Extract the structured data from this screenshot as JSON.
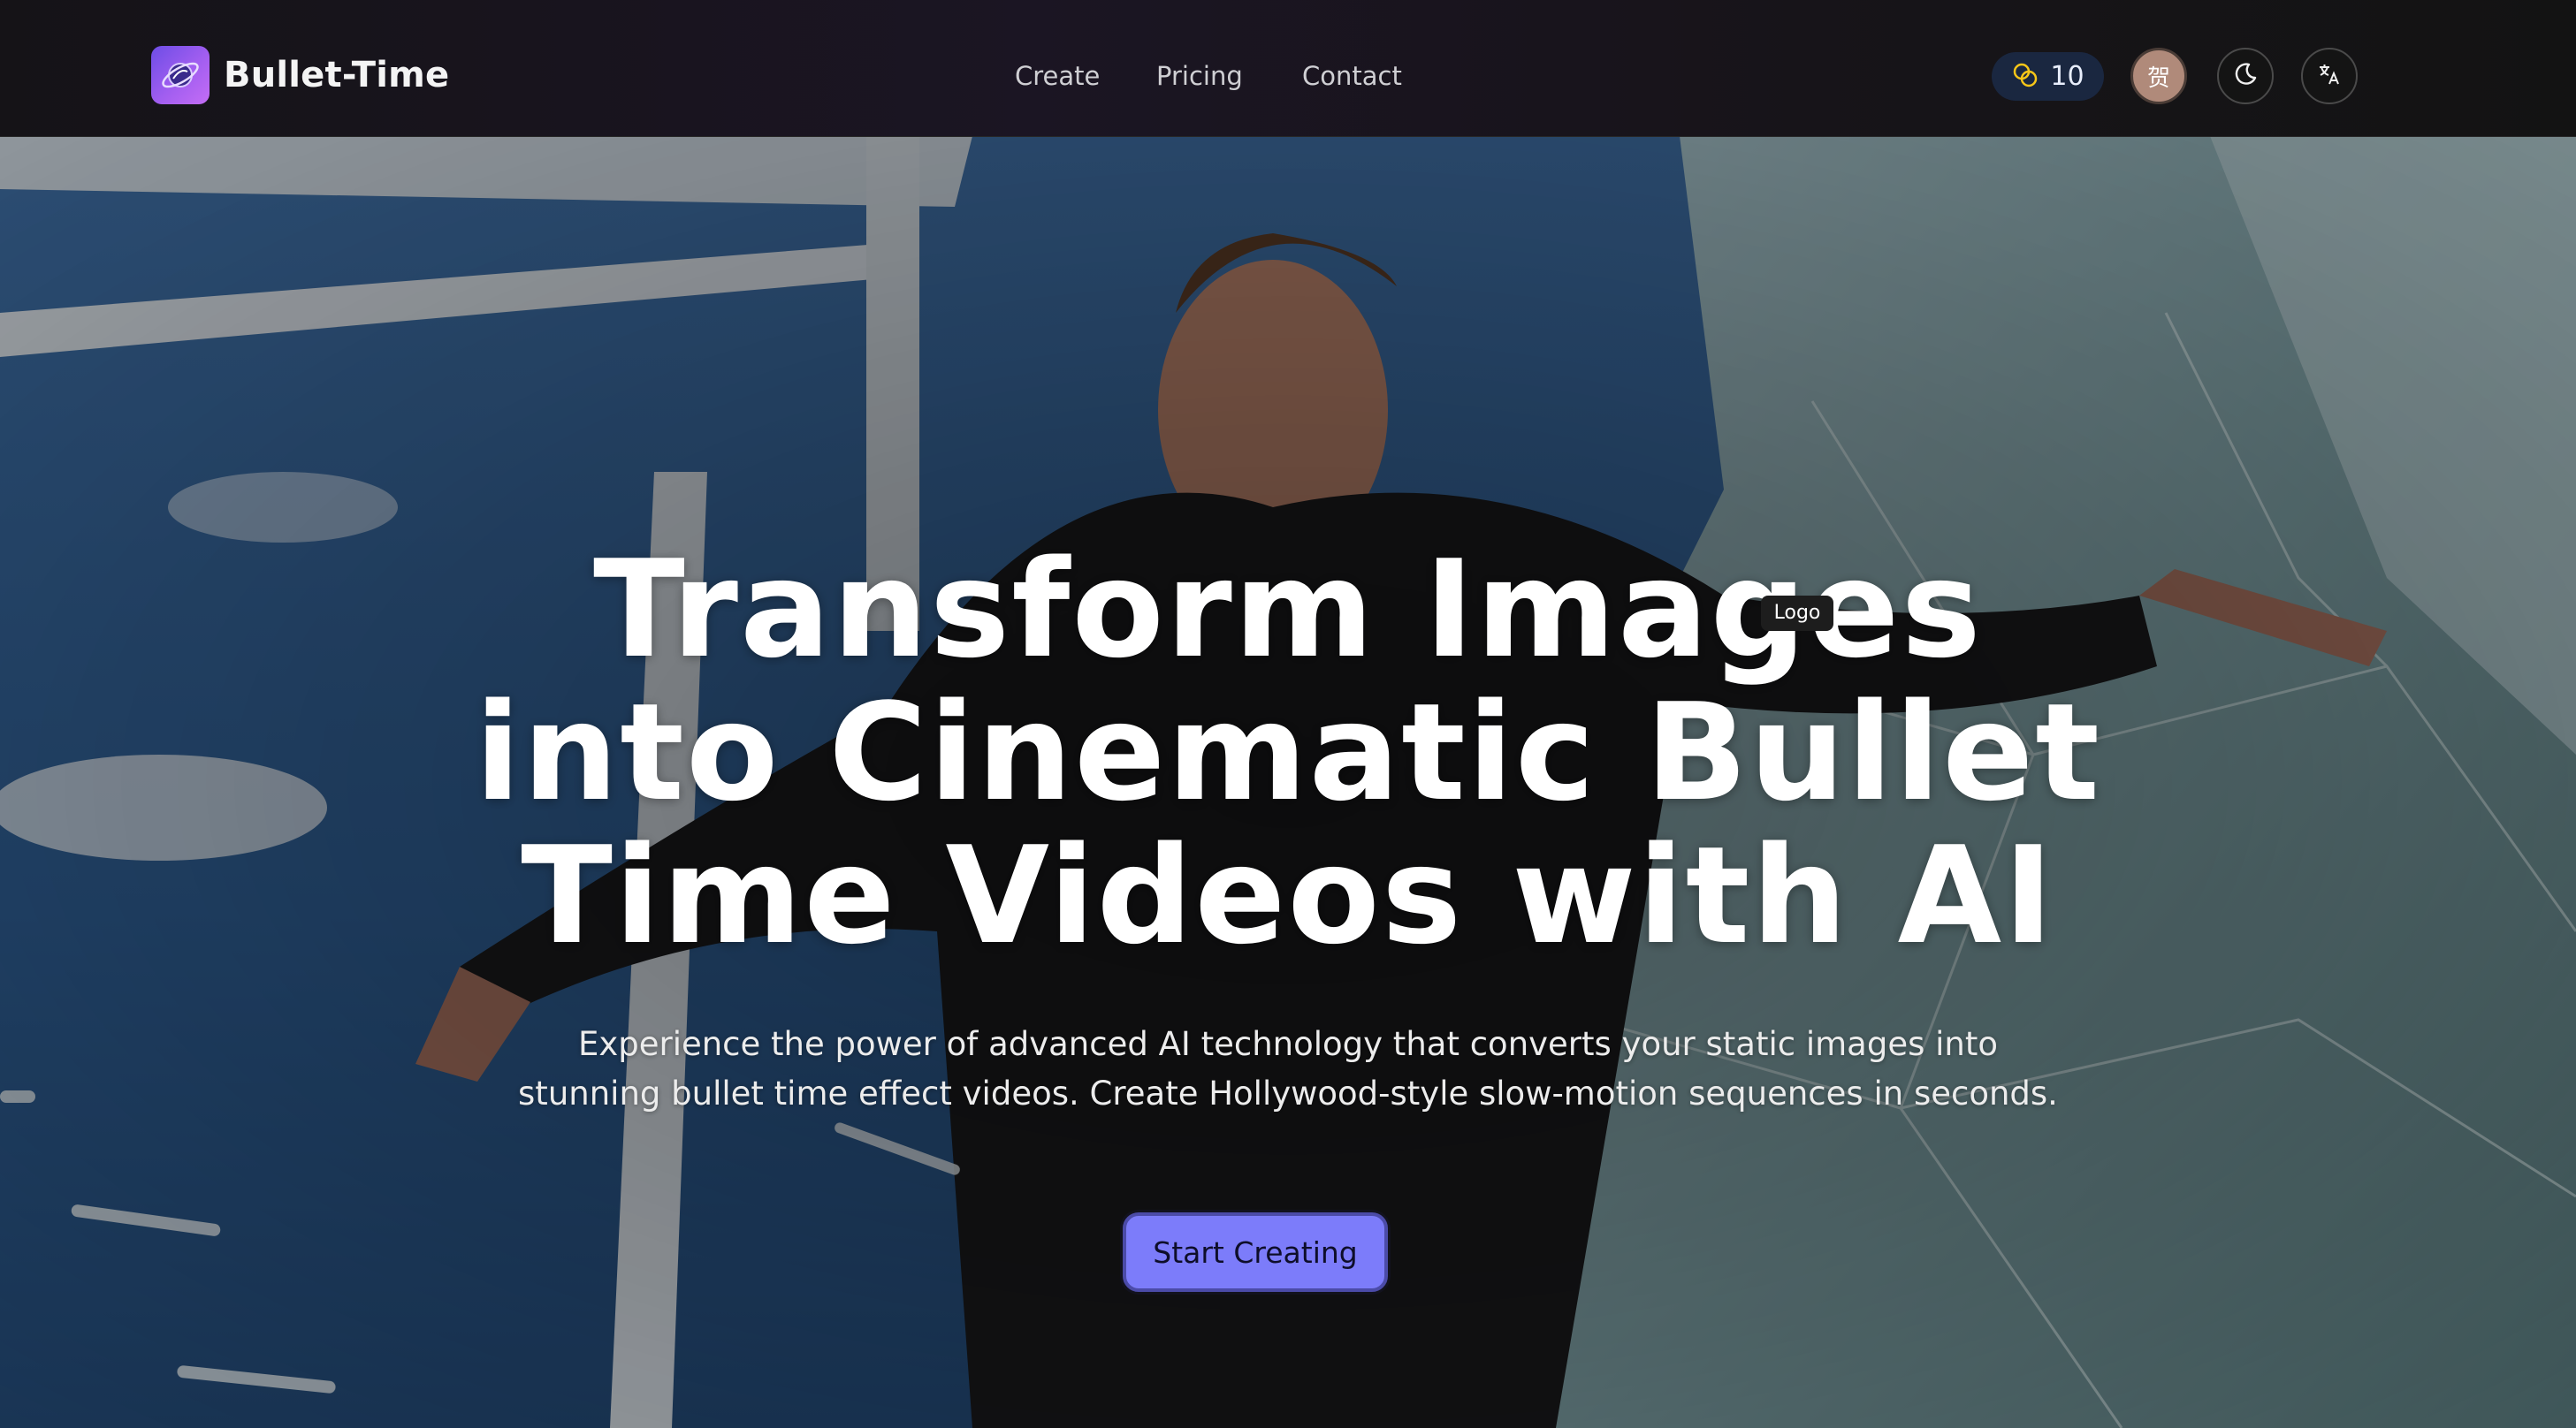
{
  "brand": {
    "name": "Bullet-Time",
    "logo_icon": "swirl-planet-icon",
    "accent": "#8b5cf6"
  },
  "nav": {
    "links": [
      {
        "label": "Create"
      },
      {
        "label": "Pricing"
      },
      {
        "label": "Contact"
      }
    ]
  },
  "header_actions": {
    "credits": {
      "icon": "coins-icon",
      "value": "10",
      "icon_color": "#f5c518"
    },
    "avatar": {
      "initial": "贺",
      "color": "#b08a7a"
    },
    "theme_toggle": {
      "icon": "moon-icon"
    },
    "language_toggle": {
      "icon": "translate-icon"
    }
  },
  "hero": {
    "headline_lines": [
      "Transform Images",
      "into Cinematic Bullet",
      "Time Videos with AI"
    ],
    "tooltip": "Logo",
    "subtitle_lines": [
      "Experience the power of advanced AI technology that converts your static images into",
      "stunning bullet time effect videos. Create Hollywood-style slow-motion sequences in seconds."
    ],
    "cta_label": "Start Creating",
    "cta_color": "#7c7cfa",
    "background": "man-breaking-through-glass-photo"
  }
}
